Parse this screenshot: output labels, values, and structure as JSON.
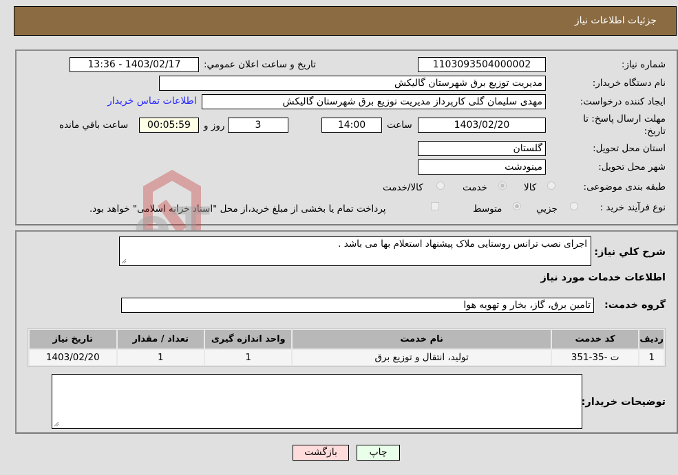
{
  "header": {
    "title": "جزئیات اطلاعات نیاز"
  },
  "form": {
    "need_number_label": "شماره نیاز:",
    "need_number": "1103093504000002",
    "announce_label": "تاریخ و ساعت اعلان عمومي:",
    "announce_value": "1403/02/17 - 13:36",
    "buyer_org_label": "نام دستگاه خریدار:",
    "buyer_org": "مدیریت توزیع برق شهرستان گالیکش",
    "creator_label": "ایجاد کننده درخواست:",
    "creator": "مهدی سلیمان گلی کارپرداز مدیریت توزیع برق شهرستان گالیکش",
    "contact_link": "اطلاعات تماس خریدار",
    "deadline_label": "مهلت ارسال پاسخ: تا تاریخ:",
    "deadline_date": "1403/02/20",
    "time_label": "ساعت",
    "deadline_time": "14:00",
    "days_value": "3",
    "days_label": "روز و",
    "remaining_time": "00:05:59",
    "remaining_label": "ساعت باقي مانده",
    "province_label": "استان محل تحویل:",
    "province": "گلستان",
    "city_label": "شهر محل تحویل:",
    "city": "مینودشت",
    "category_label": "طبقه بندی موضوعی:",
    "category_options": [
      {
        "label": "کالا",
        "checked": false
      },
      {
        "label": "خدمت",
        "checked": true
      },
      {
        "label": "کالا/خدمت",
        "checked": false
      }
    ],
    "process_label": "نوع فرآیند خرید :",
    "process_options": [
      {
        "label": "جزيي",
        "checked": false
      },
      {
        "label": "متوسط",
        "checked": true
      }
    ],
    "payment_note": "پرداخت تمام یا بخشی از مبلغ خرید،از محل \"اسناد خزانه اسلامی\" خواهد بود."
  },
  "details": {
    "description_label": "شرح کلي نیاز:",
    "description": "اجرای نصب ترانس روستایی ملاک پیشنهاد استعلام  بها می باشد .",
    "services_heading": "اطلاعات خدمات مورد نیاز",
    "service_group_label": "گروه خدمت:",
    "service_group": "تامین برق، گاز، بخار و تهویه هوا",
    "table": {
      "headers": [
        "ردیف",
        "کد خدمت",
        "نام خدمت",
        "واحد اندازه گیری",
        "تعداد / مقدار",
        "تاریخ نیاز"
      ],
      "rows": [
        [
          "1",
          "ت -35-351",
          "تولید، انتقال و توزیع برق",
          "1",
          "1",
          "1403/02/20"
        ]
      ]
    },
    "buyer_notes_label": "توضیحات خریدار:",
    "buyer_notes": ""
  },
  "buttons": {
    "print": "چاپ",
    "back": "بازگشت"
  },
  "watermark": {
    "text": "AriaTender.neT"
  },
  "colors": {
    "header_bg": "#8b6b42",
    "print_bg": "#eaffea",
    "back_bg": "#ffdcdc",
    "link": "#2a2aff"
  }
}
